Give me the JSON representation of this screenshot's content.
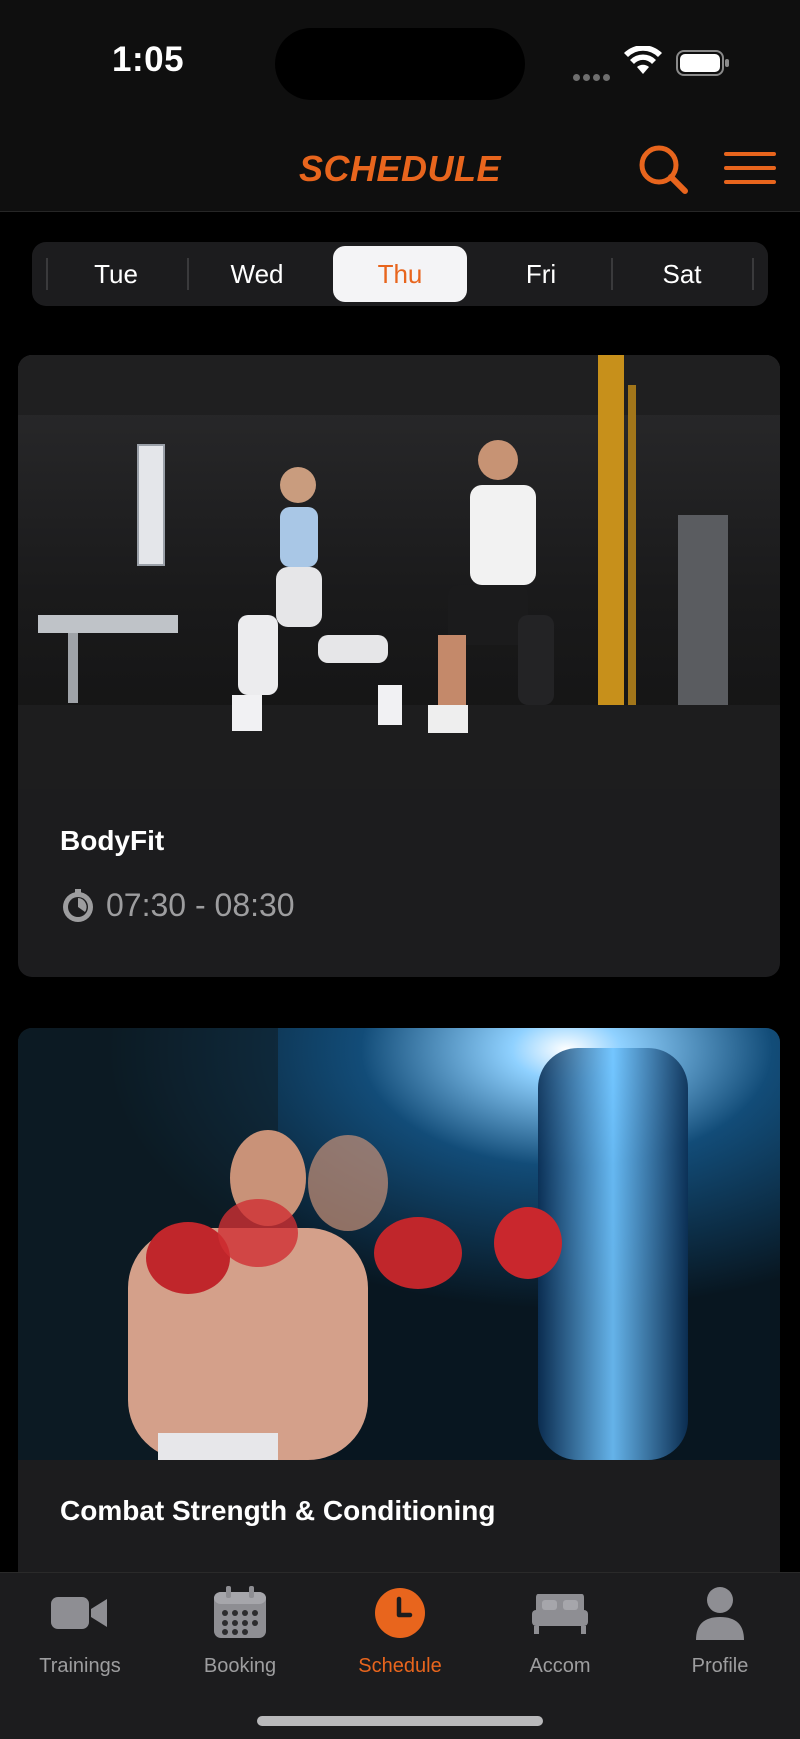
{
  "status_bar": {
    "time": "1:05"
  },
  "header": {
    "title": "SCHEDULE"
  },
  "day_tabs": [
    {
      "label": "Tue"
    },
    {
      "label": "Wed"
    },
    {
      "label": "Thu"
    },
    {
      "label": "Fri"
    },
    {
      "label": "Sat"
    }
  ],
  "selected_day": "Thu",
  "classes": [
    {
      "title": "BodyFit",
      "time": "07:30 - 08:30",
      "image": "gym-lunge-couple-photo"
    },
    {
      "title": "Combat Strength & Conditioning",
      "image": "boxer-punching-bag-photo"
    }
  ],
  "tab_bar": {
    "items": [
      {
        "label": "Trainings",
        "icon": "video-camera-icon"
      },
      {
        "label": "Booking",
        "icon": "calendar-icon"
      },
      {
        "label": "Schedule",
        "icon": "clock-icon"
      },
      {
        "label": "Accom",
        "icon": "bed-icon"
      },
      {
        "label": "Profile",
        "icon": "person-icon"
      }
    ],
    "active": "Schedule"
  },
  "colors": {
    "accent": "#e8651d",
    "background": "#000000",
    "card": "#1c1c1e",
    "muted_text": "#9d9d9f"
  }
}
